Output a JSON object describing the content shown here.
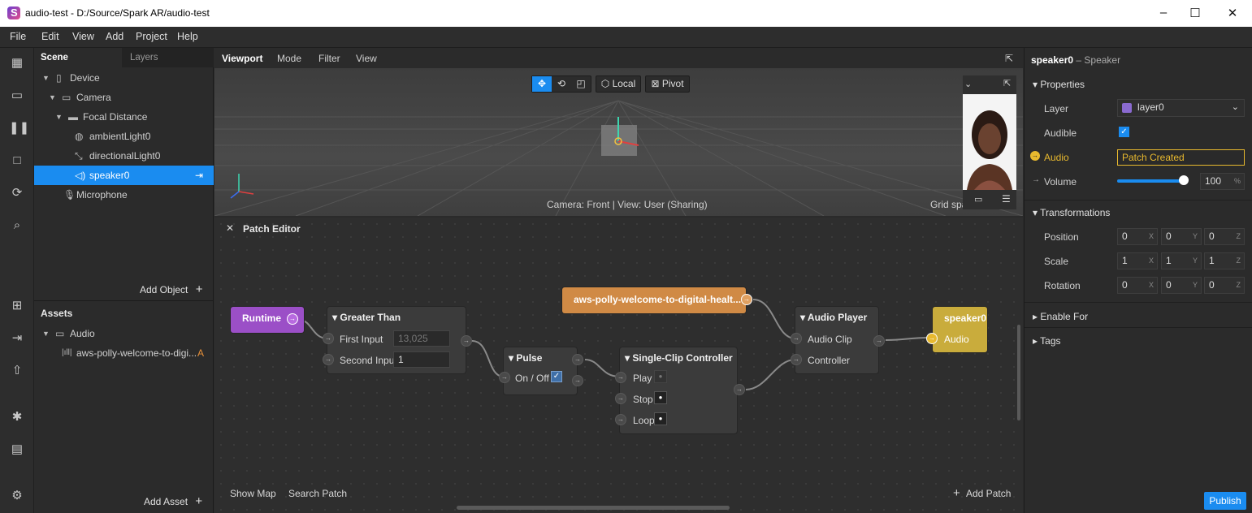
{
  "window": {
    "title": "audio-test - D:/Source/Spark AR/audio-test"
  },
  "menu": [
    "File",
    "Edit",
    "View",
    "Add",
    "Project",
    "Help"
  ],
  "scene": {
    "tabs": [
      "Scene",
      "Layers"
    ],
    "tree": [
      {
        "label": "Device",
        "icon": "phone-icon"
      },
      {
        "label": "Camera",
        "icon": "camera-icon"
      },
      {
        "label": "Focal Distance",
        "icon": "focal-icon"
      },
      {
        "label": "ambientLight0",
        "icon": "ambient-light-icon"
      },
      {
        "label": "directionalLight0",
        "icon": "directional-light-icon"
      },
      {
        "label": "speaker0",
        "icon": "speaker-icon"
      },
      {
        "label": "Microphone",
        "icon": "microphone-icon"
      }
    ],
    "add_object": "Add Object"
  },
  "assets": {
    "title": "Assets",
    "folder": "Audio",
    "file": "aws-polly-welcome-to-digi...",
    "file_badge": "A",
    "add_asset": "Add Asset"
  },
  "viewport": {
    "tabs": [
      "Viewport",
      "Mode",
      "Filter",
      "View"
    ],
    "local": "Local",
    "pivot": "Pivot",
    "status": "Camera: Front | View: User (Sharing)",
    "grid": "Grid spa"
  },
  "patch": {
    "title": "Patch Editor",
    "runtime": "Runtime",
    "greater_than": {
      "title": "Greater Than",
      "first": "First Input",
      "first_val": "13,025",
      "second": "Second Input",
      "second_val": "1"
    },
    "pulse": {
      "title": "Pulse",
      "onoff": "On / Off"
    },
    "clip": {
      "title": "Single-Clip Controller",
      "play": "Play",
      "stop": "Stop",
      "loop": "Loop"
    },
    "asset": "aws-polly-welcome-to-digital-healt...",
    "player": {
      "title": "Audio Player",
      "clip": "Audio Clip",
      "controller": "Controller"
    },
    "speaker": {
      "title": "speaker0",
      "audio": "Audio"
    },
    "show_map": "Show Map",
    "search_patch": "Search Patch",
    "add_patch": "Add Patch"
  },
  "props": {
    "header_name": "speaker0",
    "header_type": "– Speaker",
    "properties": "Properties",
    "layer_label": "Layer",
    "layer_value": "layer0",
    "audible_label": "Audible",
    "audio_label": "Audio",
    "audio_value": "Patch Created",
    "volume_label": "Volume",
    "volume_value": "100",
    "volume_unit": "%",
    "volume_fraction": 0.86,
    "transformations": "Transformations",
    "position_label": "Position",
    "position": [
      "0",
      "0",
      "0"
    ],
    "scale_label": "Scale",
    "scale": [
      "1",
      "1",
      "1"
    ],
    "rotation_label": "Rotation",
    "rotation": [
      "0",
      "0",
      "0"
    ],
    "axes": [
      "X",
      "Y",
      "Z"
    ],
    "enable_for": "Enable For",
    "tags": "Tags",
    "publish": "Publish"
  },
  "colors": {
    "accent": "#1a8cf0",
    "runtime": "#9b4fc7",
    "asset": "#d08a45",
    "speaker": "#c9ac3c",
    "audio_highlight": "#e8b92e"
  }
}
